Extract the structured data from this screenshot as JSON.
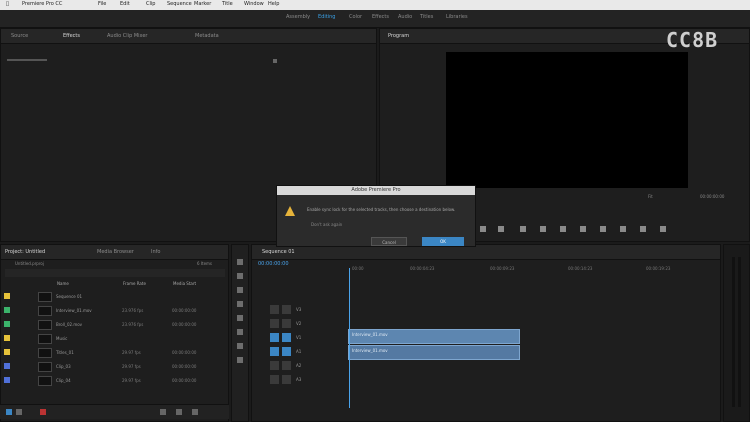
{
  "menu_bar": {
    "items": [
      "Premiere Pro CC",
      "File",
      "Edit",
      "Clip",
      "Sequence",
      "Marker",
      "Title",
      "Window",
      "Help"
    ]
  },
  "workspace": {
    "items": [
      "Assembly",
      "Editing",
      "Color",
      "Effects",
      "Audio",
      "Titles",
      "Libraries"
    ],
    "active_index": 1
  },
  "source_panel": {
    "tabs": [
      "Source",
      "Effects",
      "Audio Clip Mixer",
      "Metadata"
    ],
    "active_index": 1
  },
  "program_panel": {
    "tab": "Program",
    "watermark": "CC8B",
    "timecode": "00:00:00:00",
    "fit": "Fit",
    "controls": [
      "mark-in-icon",
      "mark-out-icon",
      "go-to-in-icon",
      "step-back-icon",
      "play-icon",
      "step-forward-icon",
      "go-to-out-icon",
      "lift-icon",
      "extract-icon",
      "export-frame-icon"
    ]
  },
  "dialog": {
    "title": "Adobe Premiere Pro",
    "message": "Enable sync lock for the selected tracks, then choose a destination below.",
    "sub_label": "Don't ask again",
    "cancel_label": "Cancel",
    "ok_label": "OK",
    "accent": "#3b86c4"
  },
  "project_panel": {
    "tabs": [
      "Project: Untitled",
      "Media Browser",
      "Info"
    ],
    "path": "Untitled.prproj",
    "count": "6 Items",
    "columns": [
      "Name",
      "Frame Rate",
      "Media Start"
    ],
    "rows": [
      {
        "name": "Sequence 01",
        "rate": "",
        "start": "",
        "color": "#e6c23a"
      },
      {
        "name": "Interview_01.mov",
        "rate": "23.976 fps",
        "start": "00:00:00:00",
        "color": "#3bb36b"
      },
      {
        "name": "Broll_02.mov",
        "rate": "23.976 fps",
        "start": "00:00:00:00",
        "color": "#3bb36b"
      },
      {
        "name": "Music",
        "rate": "",
        "start": "",
        "color": "#e6c23a"
      },
      {
        "name": "Titles_01",
        "rate": "29.97 fps",
        "start": "00:00:00:00",
        "color": "#e6c23a"
      },
      {
        "name": "Clip_03",
        "rate": "29.97 fps",
        "start": "00:00:00:00",
        "color": "#5070d8"
      },
      {
        "name": "Clip_04",
        "rate": "29.97 fps",
        "start": "00:00:00:00",
        "color": "#5070d8"
      }
    ]
  },
  "timeline": {
    "tab": "Sequence 01",
    "timecode": "00:00:00:00",
    "ruler": [
      "00:00",
      "00:00:04:23",
      "00:00:09:23",
      "00:00:14:23",
      "00:00:19:23"
    ],
    "tracks": [
      "V3",
      "V2",
      "V1",
      "A1",
      "A2",
      "A3"
    ],
    "clips": [
      {
        "label": "Interview_01.mov"
      },
      {
        "label": "Interview_01.mov"
      }
    ]
  }
}
